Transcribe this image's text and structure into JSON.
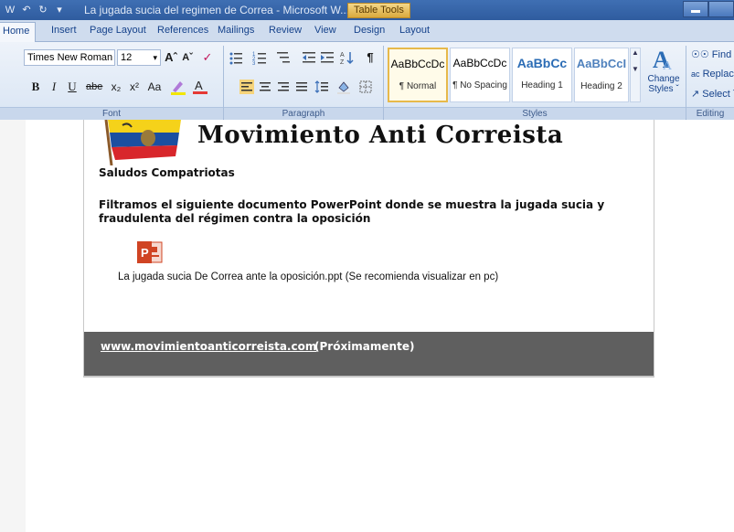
{
  "window": {
    "title": "La jugada sucia del regimen de Correa - Microsoft W...",
    "contextual_tab": "Table Tools"
  },
  "tabs": [
    "Home",
    "Insert",
    "Page Layout",
    "References",
    "Mailings",
    "Review",
    "View",
    "Design",
    "Layout"
  ],
  "active_tab": "Home",
  "ribbon": {
    "font": {
      "name": "Times New Roman",
      "size": "12",
      "group_label": "Font",
      "bold": "B",
      "italic": "I",
      "underline": "U",
      "strike": "abe",
      "subscript": "x₂",
      "superscript": "x²",
      "change_case": "Aa",
      "grow": "Aˆ",
      "shrink": "Aˇ"
    },
    "paragraph": {
      "group_label": "Paragraph",
      "pilcrow": "¶"
    },
    "styles": {
      "group_label": "Styles",
      "items": [
        {
          "sample": "AaBbCcDc",
          "name": "¶ Normal"
        },
        {
          "sample": "AaBbCcDc",
          "name": "¶ No Spacing"
        },
        {
          "sample": "AaBbCc",
          "name": "Heading 1"
        },
        {
          "sample": "AaBbCcI",
          "name": "Heading 2"
        }
      ],
      "change_styles": "Change Styles ˇ"
    },
    "editing": {
      "group_label": "Editing",
      "find": "Find ˇ",
      "replace": "Replace",
      "select": "Select ˇ"
    }
  },
  "document": {
    "heading": "Movimiento Anti Correista",
    "greeting": "Saludos Compatriotas",
    "body": "Filtramos el siguiente documento PowerPoint donde se muestra la jugada sucia y fraudulenta del régimen contra la oposición",
    "attachment_caption": "La jugada sucia De Correa ante la oposición.ppt (Se recomienda visualizar en pc)",
    "footer_link": "www.movimientoanticorreista.com",
    "footer_note": "(Próximamente)"
  },
  "colors": {
    "title_bar": "#2f5c9f",
    "footer_bg": "#5f5f5f",
    "ppt_red": "#d04423",
    "style_heading_blue": "#2b6cb5"
  }
}
